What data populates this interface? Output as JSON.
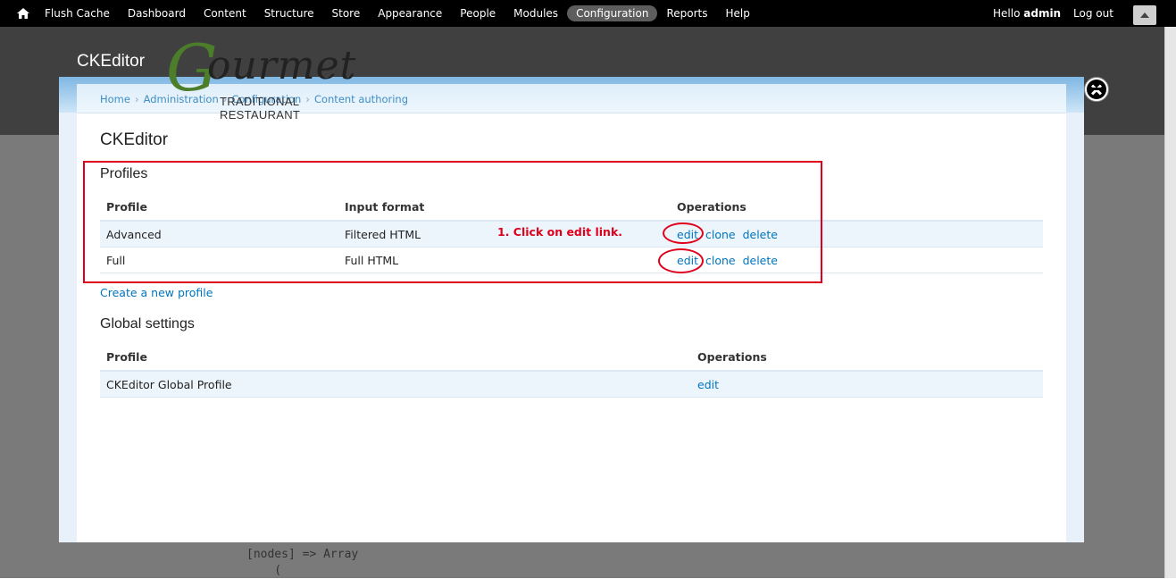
{
  "toolbar": {
    "items": [
      "Flush Cache",
      "Dashboard",
      "Content",
      "Structure",
      "Store",
      "Appearance",
      "People",
      "Modules",
      "Configuration",
      "Reports",
      "Help"
    ],
    "active": "Configuration",
    "hello": "Hello",
    "username": "admin",
    "logout": "Log out"
  },
  "background": {
    "site_title": "CKEditor",
    "debug_line1": "[nodes] => Array",
    "debug_line2": "    ("
  },
  "logo": {
    "g": "G",
    "rest": "ourmet",
    "tagline": "TRADITIONAL RESTAURANT"
  },
  "breadcrumb": [
    "Home",
    "Administration",
    "Configuration",
    "Content authoring"
  ],
  "page_title": "CKEditor",
  "profiles": {
    "heading": "Profiles",
    "columns": [
      "Profile",
      "Input format",
      "Operations"
    ],
    "rows": [
      {
        "profile": "Advanced",
        "format": "Filtered HTML",
        "ops": [
          "edit",
          "clone",
          "delete"
        ]
      },
      {
        "profile": "Full",
        "format": "Full HTML",
        "ops": [
          "edit",
          "clone",
          "delete"
        ]
      }
    ],
    "create_link": "Create a new profile"
  },
  "global": {
    "heading": "Global settings",
    "columns": [
      "Profile",
      "Operations"
    ],
    "rows": [
      {
        "profile": "CKEditor Global Profile",
        "ops": [
          "edit"
        ]
      }
    ]
  },
  "annotation": {
    "note": "1. Click on edit link.",
    "color": "#e0001b"
  }
}
